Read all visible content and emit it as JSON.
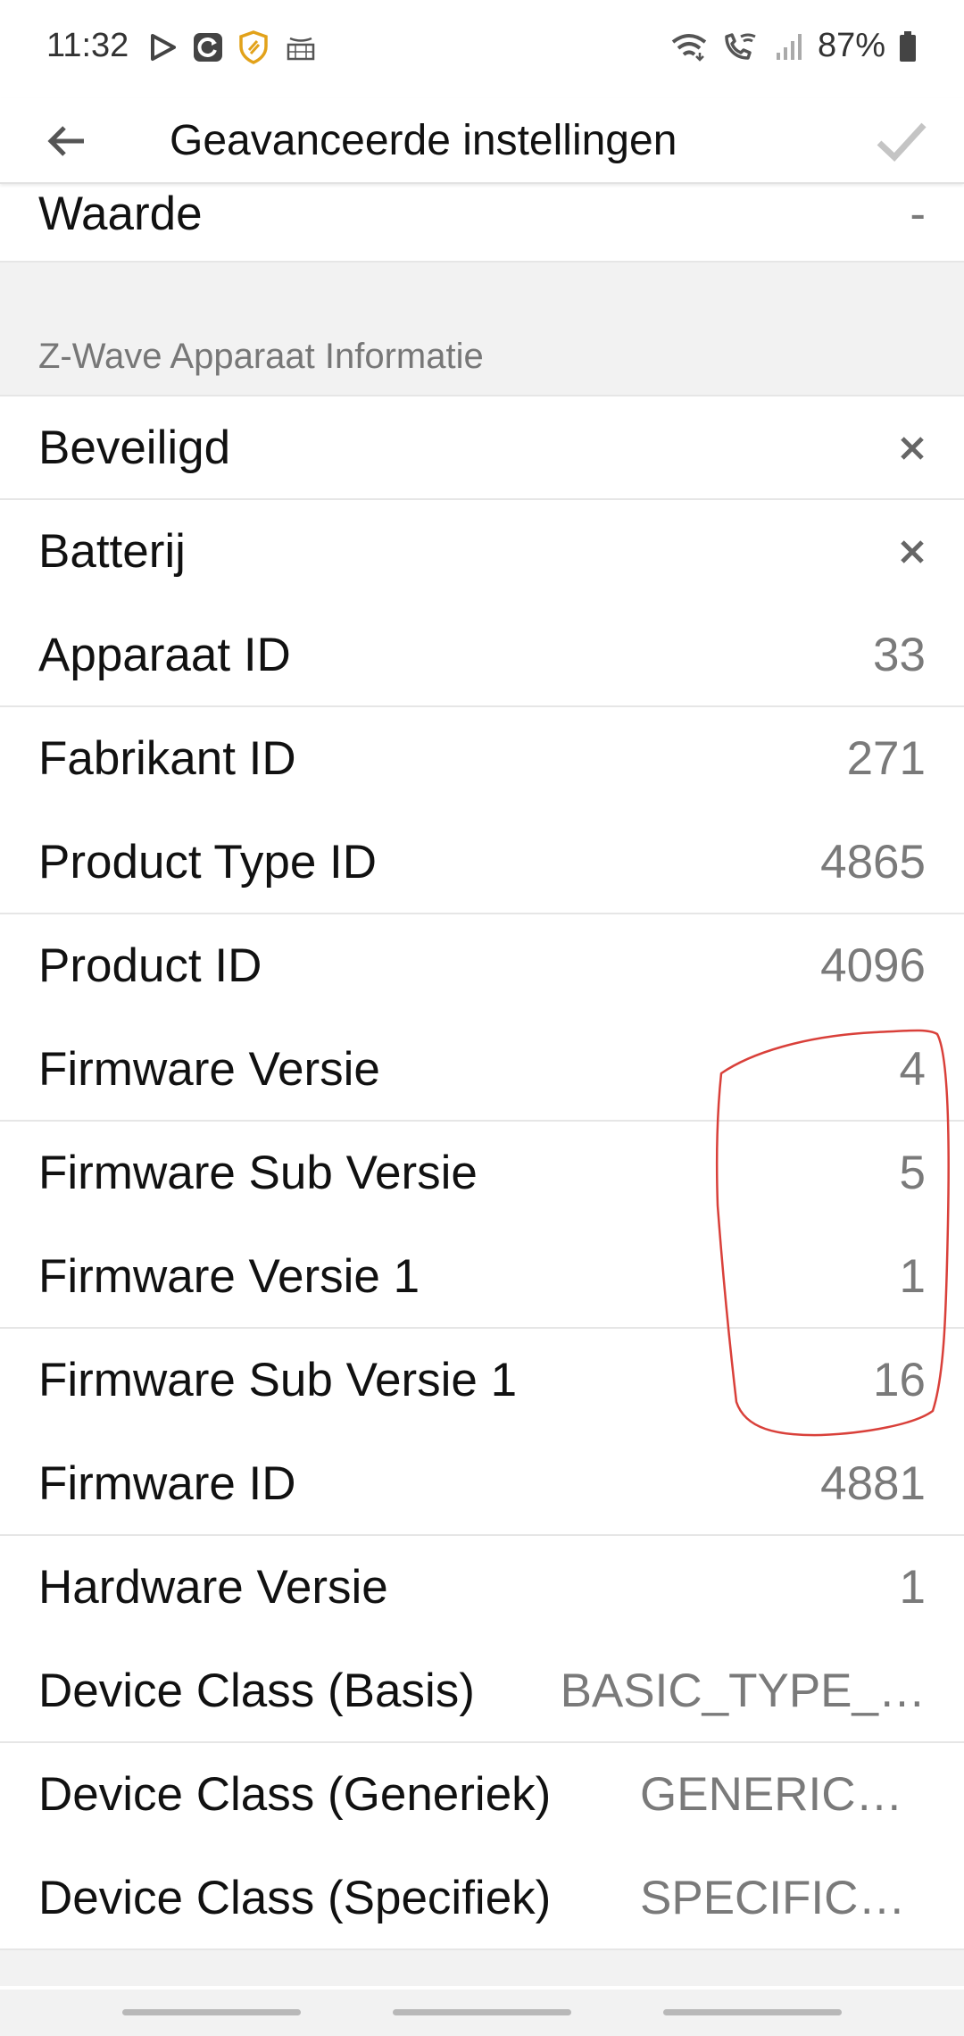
{
  "status": {
    "time": "11:32",
    "battery": "87%",
    "left_icons": [
      "play-icon",
      "sync-icon",
      "shield-app-icon",
      "amazon-icon"
    ],
    "right_icons": [
      "wifi-icon",
      "wifi-call-icon",
      "signal-icon",
      "battery-icon"
    ]
  },
  "appbar": {
    "title": "Geavanceerde instellingen",
    "back_icon": "arrow-back-icon",
    "confirm_icon": "check-icon"
  },
  "top_row": {
    "label": "Waarde",
    "value": "-"
  },
  "section": {
    "title": "Z-Wave Apparaat Informatie",
    "rows": [
      {
        "label": "Beveiligd",
        "value": "×"
      },
      {
        "label": "Batterij",
        "value": "×"
      },
      {
        "label": "Apparaat ID",
        "value": "33"
      },
      {
        "label": "Fabrikant ID",
        "value": "271"
      },
      {
        "label": "Product Type ID",
        "value": "4865"
      },
      {
        "label": "Product ID",
        "value": "4096"
      },
      {
        "label": "Firmware Versie",
        "value": "4"
      },
      {
        "label": "Firmware Sub Versie",
        "value": "5"
      },
      {
        "label": "Firmware Versie 1",
        "value": "1"
      },
      {
        "label": "Firmware Sub Versie 1",
        "value": "16"
      },
      {
        "label": "Firmware ID",
        "value": "4881"
      },
      {
        "label": "Hardware Versie",
        "value": "1"
      },
      {
        "label": "Device Class (Basis)",
        "value": "BASIC_TYPE_…"
      },
      {
        "label": "Device Class (Generiek)",
        "value": "GENERIC_…"
      },
      {
        "label": "Device Class (Specifiek)",
        "value": "SPECIFIC_…"
      }
    ]
  },
  "colors": {
    "annotation": "#d9403a",
    "value_text": "#7a7a7a",
    "section_bg": "#f2f2f2"
  }
}
